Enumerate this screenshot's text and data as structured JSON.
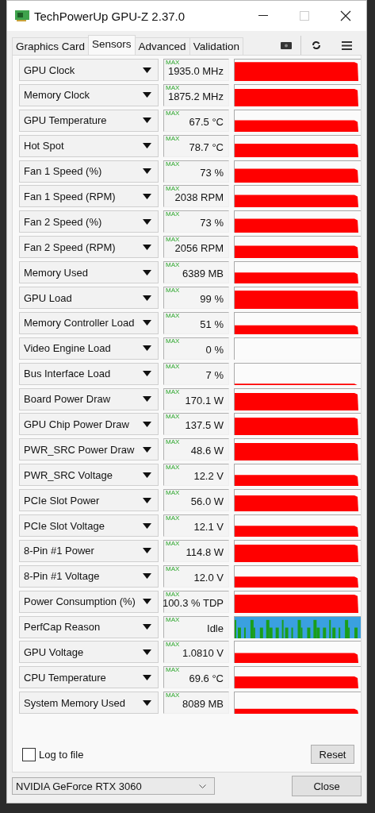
{
  "window": {
    "title": "TechPowerUp GPU-Z 2.37.0"
  },
  "tabs": [
    {
      "label": "Graphics Card",
      "selected": false
    },
    {
      "label": "Sensors",
      "selected": true
    },
    {
      "label": "Advanced",
      "selected": false
    },
    {
      "label": "Validation",
      "selected": false
    }
  ],
  "sensors": [
    {
      "name": "GPU Clock",
      "badge": "MAX",
      "value": "1935.0 MHz",
      "kind": "graph"
    },
    {
      "name": "Memory Clock",
      "badge": "MAX",
      "value": "1875.2 MHz",
      "kind": "graph"
    },
    {
      "name": "GPU Temperature",
      "badge": "MAX",
      "value": "67.5 °C",
      "kind": "graph"
    },
    {
      "name": "Hot Spot",
      "badge": "MAX",
      "value": "78.7 °C",
      "kind": "graph"
    },
    {
      "name": "Fan 1 Speed (%)",
      "badge": "MAX",
      "value": "73 %",
      "kind": "graph"
    },
    {
      "name": "Fan 1 Speed (RPM)",
      "badge": "MAX",
      "value": "2038 RPM",
      "kind": "graph"
    },
    {
      "name": "Fan 2 Speed (%)",
      "badge": "MAX",
      "value": "73 %",
      "kind": "graph"
    },
    {
      "name": "Fan 2 Speed (RPM)",
      "badge": "MAX",
      "value": "2056 RPM",
      "kind": "graph"
    },
    {
      "name": "Memory Used",
      "badge": "MAX",
      "value": "6389 MB",
      "kind": "graph"
    },
    {
      "name": "GPU Load",
      "badge": "MAX",
      "value": "99 %",
      "kind": "graph"
    },
    {
      "name": "Memory Controller Load",
      "badge": "MAX",
      "value": "51 %",
      "kind": "graph"
    },
    {
      "name": "Video Engine Load",
      "badge": "MAX",
      "value": "0 %",
      "kind": "graph"
    },
    {
      "name": "Bus Interface Load",
      "badge": "MAX",
      "value": "7 %",
      "kind": "graph"
    },
    {
      "name": "Board Power Draw",
      "badge": "MAX",
      "value": "170.1 W",
      "kind": "graph"
    },
    {
      "name": "GPU Chip Power Draw",
      "badge": "MAX",
      "value": "137.5 W",
      "kind": "graph"
    },
    {
      "name": "PWR_SRC Power Draw",
      "badge": "MAX",
      "value": "48.6 W",
      "kind": "graph"
    },
    {
      "name": "PWR_SRC Voltage",
      "badge": "MAX",
      "value": "12.2 V",
      "kind": "graph"
    },
    {
      "name": "PCIe Slot Power",
      "badge": "MAX",
      "value": "56.0 W",
      "kind": "graph"
    },
    {
      "name": "PCIe Slot Voltage",
      "badge": "MAX",
      "value": "12.1 V",
      "kind": "graph"
    },
    {
      "name": "8-Pin #1 Power",
      "badge": "MAX",
      "value": "114.8 W",
      "kind": "graph"
    },
    {
      "name": "8-Pin #1 Voltage",
      "badge": "MAX",
      "value": "12.0 V",
      "kind": "graph"
    },
    {
      "name": "Power Consumption (%)",
      "badge": "MAX",
      "value": "100.3 % TDP",
      "kind": "graph"
    },
    {
      "name": "PerfCap Reason",
      "badge": "MAX",
      "value": "Idle",
      "kind": "perfcap"
    },
    {
      "name": "GPU Voltage",
      "badge": "MAX",
      "value": "1.0810 V",
      "kind": "graph"
    },
    {
      "name": "CPU Temperature",
      "badge": "MAX",
      "value": "69.6 °C",
      "kind": "graph"
    },
    {
      "name": "System Memory Used",
      "badge": "MAX",
      "value": "8089 MB",
      "kind": "graph"
    }
  ],
  "log_to_file": {
    "label": "Log to file",
    "checked": false
  },
  "reset_button": "Reset",
  "gpu_select": {
    "value": "NVIDIA GeForce RTX 3060"
  },
  "close_button": "Close"
}
